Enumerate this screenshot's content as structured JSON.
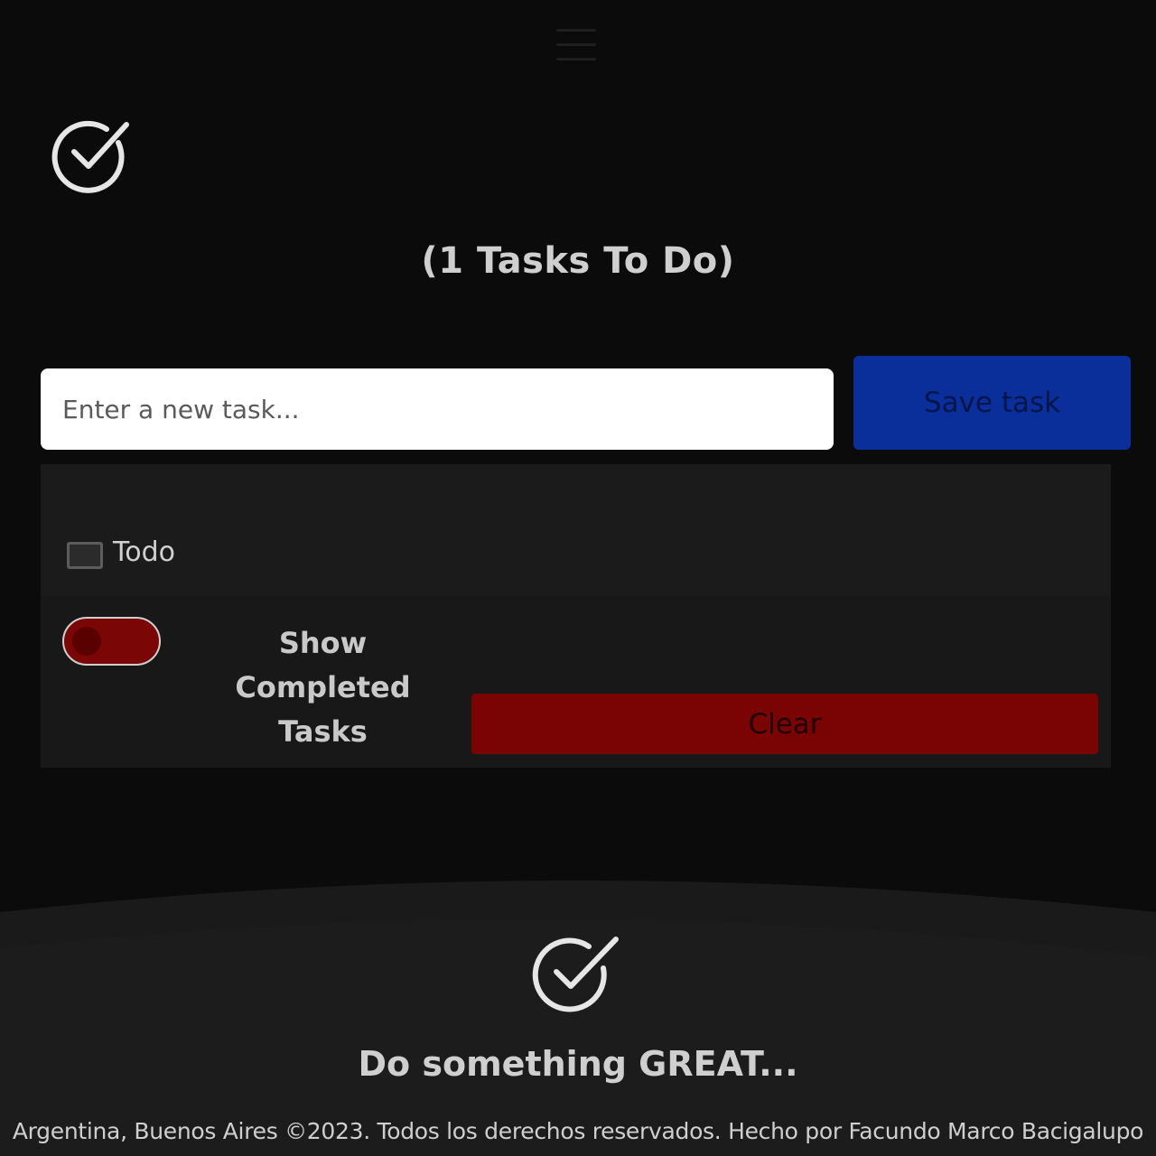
{
  "header": {
    "menu_icon": "hamburger-menu-icon",
    "logo_icon": "check-circle-icon"
  },
  "main": {
    "title": "(1 Tasks To Do)",
    "task_input": {
      "value": "",
      "placeholder": "Enter a new task..."
    },
    "save_button_label": "Save task",
    "tasks": [
      {
        "label": "Todo",
        "completed": false
      }
    ],
    "show_completed": {
      "label": "Show Completed Tasks",
      "enabled": false
    },
    "clear_button_label": "Clear"
  },
  "footer": {
    "logo_icon": "check-circle-icon",
    "slogan": "Do something GREAT...",
    "copyright": "Argentina, Buenos Aires ©2023. Todos los derechos reservados. Hecho por Facundo Marco Bacigalupo"
  },
  "colors": {
    "background": "#0b0b0b",
    "panel": "#181818",
    "save_button": "#0a2f9b",
    "clear_button": "#7a0303",
    "toggle_off": "#7a0606",
    "text": "#cfcfcf"
  }
}
